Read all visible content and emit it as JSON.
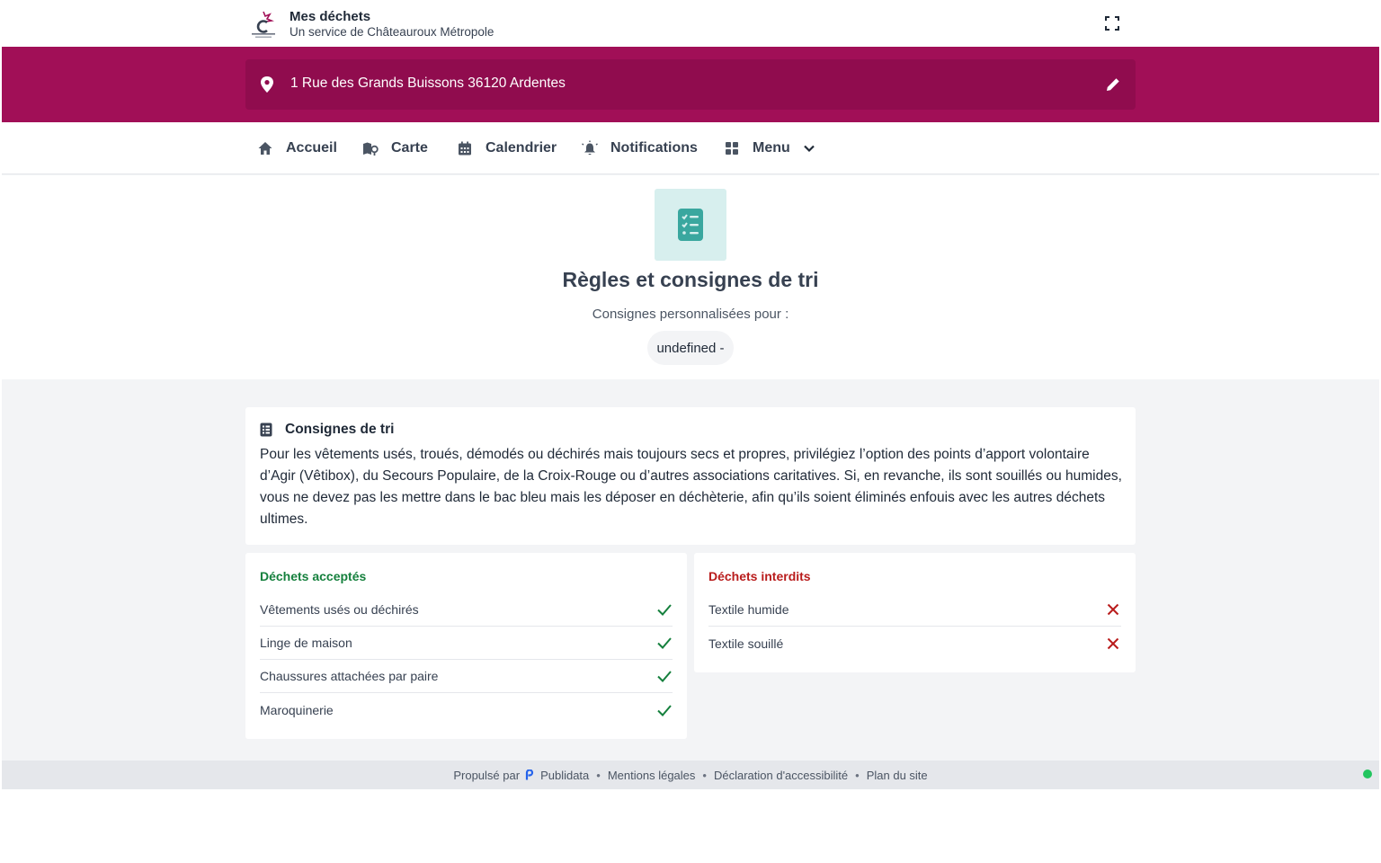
{
  "header": {
    "title": "Mes déchets",
    "subtitle": "Un service de Châteauroux Métropole"
  },
  "address": {
    "text": "1 Rue des Grands Buissons 36120 Ardentes"
  },
  "nav": {
    "items": [
      {
        "label": "Accueil",
        "icon": "home-icon"
      },
      {
        "label": "Carte",
        "icon": "map-icon"
      },
      {
        "label": "Calendrier",
        "icon": "calendar-icon"
      },
      {
        "label": "Notifications",
        "icon": "bell-icon"
      },
      {
        "label": "Menu",
        "icon": "grid-icon"
      }
    ]
  },
  "hero": {
    "title": "Règles et consignes de tri",
    "subtitle": "Consignes personnalisées pour :",
    "tag": "undefined -"
  },
  "consignes": {
    "title": "Consignes de tri",
    "text": "Pour les vêtements usés, troués, démodés ou déchirés mais toujours secs et propres, privilégiez l’option des points d’apport volontaire d’Agir (Vêtibox), du Secours Populaire, de la Croix-Rouge ou d’autres associations caritatives. Si, en revanche, ils sont souillés ou humides, vous ne devez pas les mettre dans le bac bleu mais les déposer en déchèterie, afin qu’ils soient éliminés enfouis avec les autres déchets ultimes."
  },
  "accepted": {
    "title": "Déchets acceptés",
    "items": [
      "Vêtements usés ou déchirés",
      "Linge de maison",
      "Chaussures attachées par paire",
      "Maroquinerie"
    ]
  },
  "forbidden": {
    "title": "Déchets interdits",
    "items": [
      "Textile humide",
      "Textile souillé"
    ]
  },
  "footer": {
    "powered_by": "Propulsé par",
    "brand": "Publidata",
    "links": [
      "Mentions légales",
      "Déclaration d'accessibilité",
      "Plan du site"
    ]
  },
  "colors": {
    "brand": "#a10f57",
    "brand_dark": "#900c4e",
    "accent_teal": "#3aa79f",
    "accepted": "#15803d",
    "forbidden": "#b91c1c",
    "status": "#22c55e"
  }
}
